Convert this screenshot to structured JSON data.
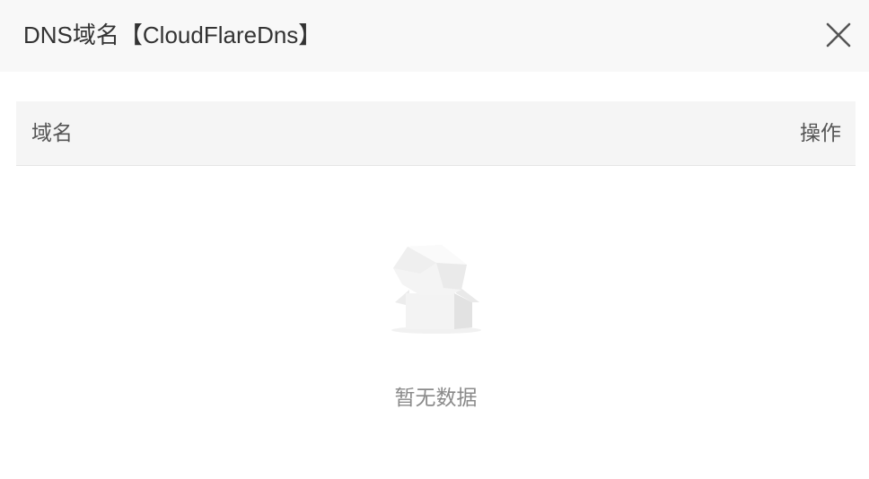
{
  "dialog": {
    "title": "DNS域名【CloudFlareDns】",
    "close_icon": "close-icon"
  },
  "table": {
    "columns": [
      {
        "label": "域名"
      },
      {
        "label": "操作"
      }
    ],
    "rows": []
  },
  "empty_state": {
    "icon": "empty-box-icon",
    "text": "暂无数据"
  },
  "colors": {
    "header_bg": "#f8f8f8",
    "table_head_bg": "#f5f5f5",
    "text_primary": "#333333",
    "text_muted": "#8a8a8a"
  }
}
